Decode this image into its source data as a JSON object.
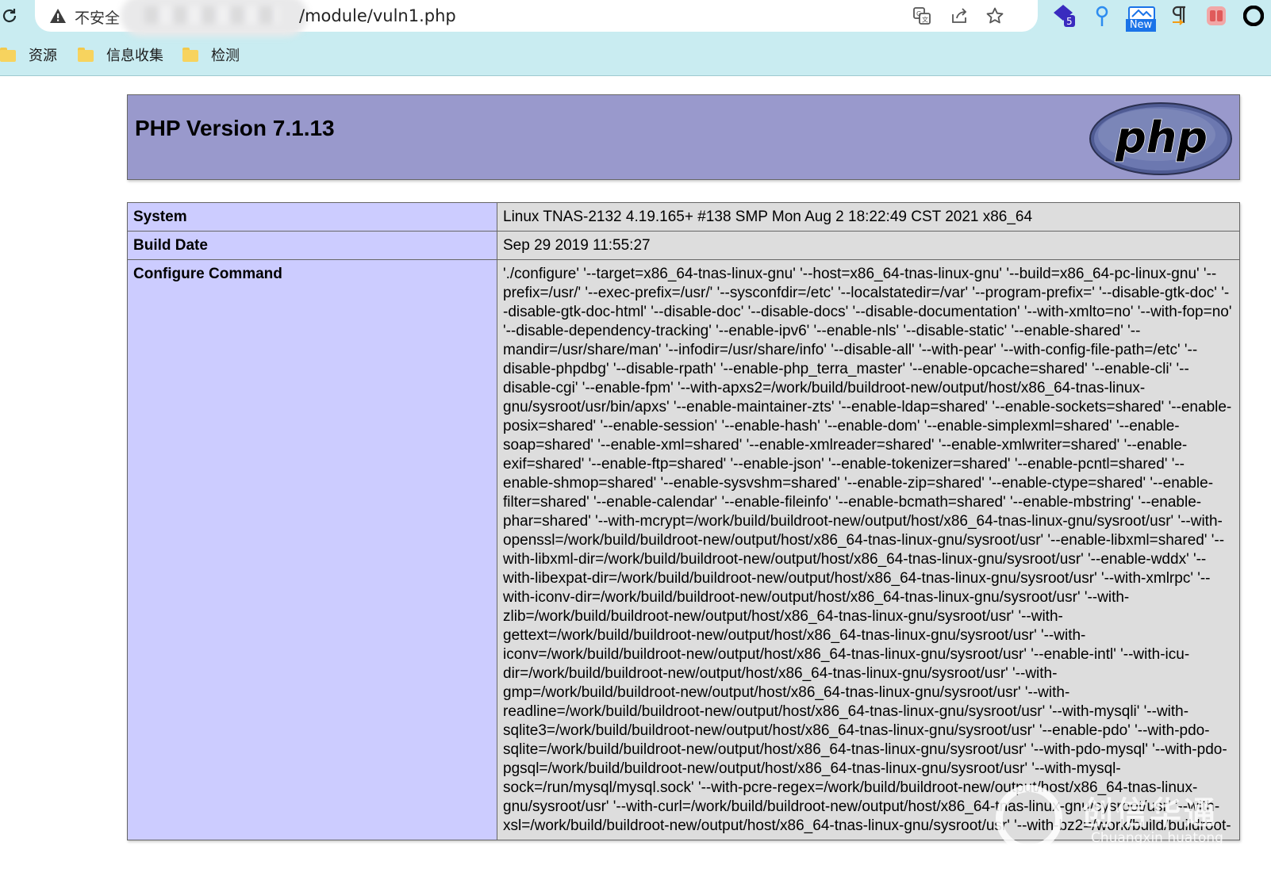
{
  "browser": {
    "security_label": "不安全",
    "url_path": "/module/vuln1.php",
    "extensions": {
      "badge_count": "5",
      "new_label": "New"
    },
    "bookmarks": [
      "资源",
      "信息收集",
      "检测"
    ]
  },
  "phpinfo": {
    "title": "PHP Version 7.1.13",
    "logo_text": "php",
    "rows": [
      {
        "label": "System",
        "value": "Linux TNAS-2132 4.19.165+ #138 SMP Mon Aug 2 18:22:49 CST 2021 x86_64"
      },
      {
        "label": "Build Date",
        "value": "Sep 29 2019 11:55:27"
      },
      {
        "label": "Configure Command",
        "value": "'./configure' '--target=x86_64-tnas-linux-gnu' '--host=x86_64-tnas-linux-gnu' '--build=x86_64-pc-linux-gnu' '--prefix=/usr/' '--exec-prefix=/usr/' '--sysconfdir=/etc' '--localstatedir=/var' '--program-prefix=' '--disable-gtk-doc' '--disable-gtk-doc-html' '--disable-doc' '--disable-docs' '--disable-documentation' '--with-xmlto=no' '--with-fop=no' '--disable-dependency-tracking' '--enable-ipv6' '--enable-nls' '--disable-static' '--enable-shared' '--mandir=/usr/share/man' '--infodir=/usr/share/info' '--disable-all' '--with-pear' '--with-config-file-path=/etc' '--disable-phpdbg' '--disable-rpath' '--enable-php_terra_master' '--enable-opcache=shared' '--enable-cli' '--disable-cgi' '--enable-fpm' '--with-apxs2=/work/build/buildroot-new/output/host/x86_64-tnas-linux-gnu/sysroot/usr/bin/apxs' '--enable-maintainer-zts' '--enable-ldap=shared' '--enable-sockets=shared' '--enable-posix=shared' '--enable-session' '--enable-hash' '--enable-dom' '--enable-simplexml=shared' '--enable-soap=shared' '--enable-xml=shared' '--enable-xmlreader=shared' '--enable-xmlwriter=shared' '--enable-exif=shared' '--enable-ftp=shared' '--enable-json' '--enable-tokenizer=shared' '--enable-pcntl=shared' '--enable-shmop=shared' '--enable-sysvshm=shared' '--enable-zip=shared' '--enable-ctype=shared' '--enable-filter=shared' '--enable-calendar' '--enable-fileinfo' '--enable-bcmath=shared' '--enable-mbstring' '--enable-phar=shared' '--with-mcrypt=/work/build/buildroot-new/output/host/x86_64-tnas-linux-gnu/sysroot/usr' '--with-openssl=/work/build/buildroot-new/output/host/x86_64-tnas-linux-gnu/sysroot/usr' '--enable-libxml=shared' '--with-libxml-dir=/work/build/buildroot-new/output/host/x86_64-tnas-linux-gnu/sysroot/usr' '--enable-wddx' '--with-libexpat-dir=/work/build/buildroot-new/output/host/x86_64-tnas-linux-gnu/sysroot/usr' '--with-xmlrpc' '--with-iconv-dir=/work/build/buildroot-new/output/host/x86_64-tnas-linux-gnu/sysroot/usr' '--with-zlib=/work/build/buildroot-new/output/host/x86_64-tnas-linux-gnu/sysroot/usr' '--with-gettext=/work/build/buildroot-new/output/host/x86_64-tnas-linux-gnu/sysroot/usr' '--with-iconv=/work/build/buildroot-new/output/host/x86_64-tnas-linux-gnu/sysroot/usr' '--enable-intl' '--with-icu-dir=/work/build/buildroot-new/output/host/x86_64-tnas-linux-gnu/sysroot/usr' '--with-gmp=/work/build/buildroot-new/output/host/x86_64-tnas-linux-gnu/sysroot/usr' '--with-readline=/work/build/buildroot-new/output/host/x86_64-tnas-linux-gnu/sysroot/usr' '--with-mysqli' '--with-sqlite3=/work/build/buildroot-new/output/host/x86_64-tnas-linux-gnu/sysroot/usr' '--enable-pdo' '--with-pdo-sqlite=/work/build/buildroot-new/output/host/x86_64-tnas-linux-gnu/sysroot/usr' '--with-pdo-mysql' '--with-pdo-pgsql=/work/build/buildroot-new/output/host/x86_64-tnas-linux-gnu/sysroot/usr' '--with-mysql-sock=/run/mysql/mysql.sock' '--with-pcre-regex=/work/build/buildroot-new/output/host/x86_64-tnas-linux-gnu/sysroot/usr' '--with-curl=/work/build/buildroot-new/output/host/x86_64-tnas-linux-gnu/sysroot/usr' '--with-xsl=/work/build/buildroot-new/output/host/x86_64-tnas-linux-gnu/sysroot/usr' '--with-bz2=/work/build/buildroot-"
      }
    ]
  },
  "watermark": {
    "cn": "创信华通",
    "en": "Chuangxin huatong"
  }
}
